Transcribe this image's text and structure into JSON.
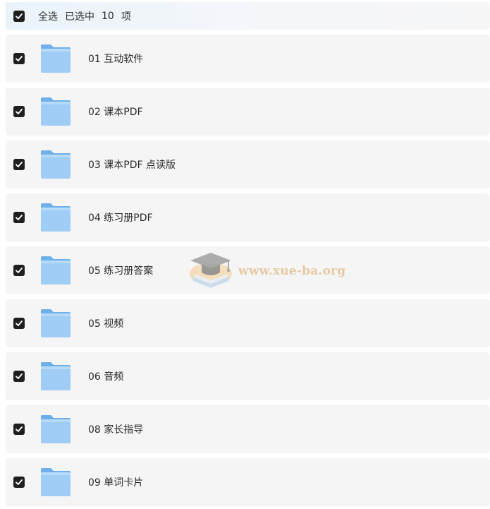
{
  "header": {
    "select_all_label": "全选",
    "selected_prefix": "已选中",
    "selected_count": "10",
    "selected_suffix": "项",
    "checked": true
  },
  "items": [
    {
      "label": "01 互动软件",
      "checked": true,
      "icon": "folder-icon"
    },
    {
      "label": "02 课本PDF",
      "checked": true,
      "icon": "folder-icon"
    },
    {
      "label": "03 课本PDF 点读版",
      "checked": true,
      "icon": "folder-icon"
    },
    {
      "label": "04 练习册PDF",
      "checked": true,
      "icon": "folder-icon"
    },
    {
      "label": "05 练习册答案",
      "checked": true,
      "icon": "folder-icon"
    },
    {
      "label": "05 视频",
      "checked": true,
      "icon": "folder-icon"
    },
    {
      "label": "06 音频",
      "checked": true,
      "icon": "folder-icon"
    },
    {
      "label": "08 家长指导",
      "checked": true,
      "icon": "folder-icon"
    },
    {
      "label": "09 单词卡片",
      "checked": true,
      "icon": "folder-icon"
    }
  ],
  "watermark": {
    "text": "www.xue-ba.org",
    "icon": "graduation-cap-book-icon"
  },
  "colors": {
    "folder_light": "#9fcdf6",
    "folder_dark": "#6fb0ea",
    "checkbox": "#1f1f1f",
    "row_bg": "#f5f5f6",
    "watermark_text": "#e7c9a2"
  }
}
